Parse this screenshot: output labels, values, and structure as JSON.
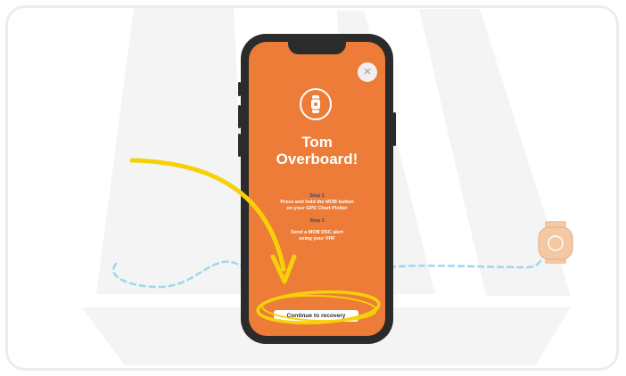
{
  "colors": {
    "screen": "#ec7c37",
    "sail": "#f4f4f4",
    "path": "#9fd6ee",
    "arrow": "#f6d10a",
    "phone": "#2b2b2b",
    "step_heading": "#274f7a",
    "crew_watch": "#f3c8a3"
  },
  "alert": {
    "close_label": "×",
    "icon": "watch-icon",
    "title_line1": "Tom",
    "title_line2": "Overboard!",
    "step1_heading": "Step 1",
    "step1_text_line1": "Press and hold the MOB button",
    "step1_text_line2": "on your GPS Chart Plotter",
    "step2_heading": "Step 2",
    "step2_text_line1": "Send a MOB DSC alert",
    "step2_text_line2": "using your VHF",
    "continue_label": "Continue to recovery"
  },
  "scene": {
    "background_icon": "sailboat-icon",
    "path_icon": "dashed-route-icon",
    "arrow_icon": "pointer-arrow-icon",
    "highlight_icon": "highlight-circle-icon",
    "crew_icon": "crew-watch-icon"
  }
}
